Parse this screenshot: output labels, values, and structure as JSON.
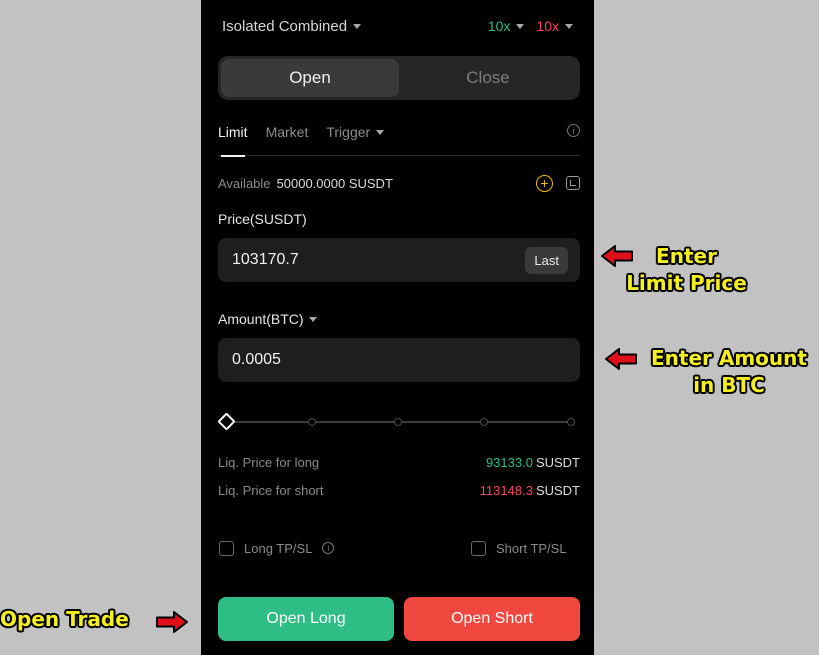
{
  "topbar": {
    "margin_mode": "Isolated Combined",
    "leverage_long": "10x",
    "leverage_short": "10x"
  },
  "segment": {
    "open": "Open",
    "close": "Close",
    "active": "open"
  },
  "order_tabs": {
    "limit": "Limit",
    "market": "Market",
    "trigger": "Trigger",
    "active": "limit"
  },
  "available": {
    "label": "Available",
    "value": "50000.0000 SUSDT"
  },
  "price": {
    "label": "Price(SUSDT)",
    "value": "103170.7",
    "last_button": "Last"
  },
  "amount": {
    "label": "Amount(BTC)",
    "value": "0.0005"
  },
  "slider": {
    "value_percent": 0,
    "stops": 5
  },
  "liquidation": {
    "long_label": "Liq. Price for long",
    "long_value": "93133.0",
    "short_label": "Liq. Price for short",
    "short_value": "113148.3",
    "unit": "SUSDT"
  },
  "tpsl": {
    "long": "Long TP/SL",
    "short": "Short TP/SL"
  },
  "actions": {
    "open_long": "Open Long",
    "open_short": "Open Short"
  },
  "annotations": {
    "price_line1": "Enter",
    "price_line2": "Limit Price",
    "amount_line1": "Enter Amount",
    "amount_line2": "in BTC",
    "open_trade": "Open Trade"
  },
  "colors": {
    "long": "#2ebd85",
    "short": "#f6465d",
    "annotation": "#f5ef1e",
    "arrow": "#e0101a",
    "accent_plus": "#f0b90b"
  }
}
